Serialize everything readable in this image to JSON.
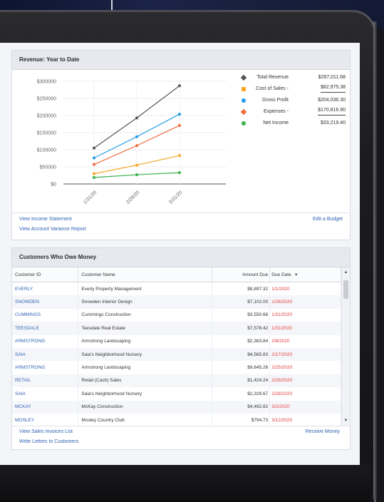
{
  "revenue": {
    "title": "Revenue: Year to Date",
    "links": {
      "income_statement": "View Income Statement",
      "variance_report": "View Account Variance Report",
      "edit_budget": "Edit a Budget"
    },
    "legend": [
      {
        "label": "Total Revenue",
        "value": "$287,011.68",
        "color": "#555555",
        "marker": "diamond",
        "underline": false
      },
      {
        "label": "Cost of Sales -",
        "value": "$82,975.38",
        "color": "#f5a623",
        "marker": "square",
        "underline": true
      },
      {
        "label": "Gross Profit",
        "value": "$204,036.30",
        "color": "#1e9be9",
        "marker": "circle",
        "underline": false
      },
      {
        "label": "Expenses -",
        "value": "$170,816.90",
        "color": "#f26b3a",
        "marker": "diamond",
        "underline": true
      },
      {
        "label": "Net Income",
        "value": "$33,219.40",
        "color": "#35b34a",
        "marker": "circle",
        "underline": false
      }
    ]
  },
  "chart_data": {
    "type": "line",
    "title": "Revenue: Year to Date",
    "categories": [
      "1/31/20",
      "2/28/20",
      "3/31/20"
    ],
    "y_ticks": [
      "$300000",
      "$250000",
      "$200000",
      "$150000",
      "$100000",
      "$50000",
      "$0"
    ],
    "ylim": [
      0,
      300000
    ],
    "grid": true,
    "legend_position": "right",
    "series": [
      {
        "name": "Total Revenue",
        "color": "#555555",
        "values": [
          105000,
          193000,
          287000
        ]
      },
      {
        "name": "Cost of Sales -",
        "color": "#f5a623",
        "values": [
          30000,
          55000,
          83000
        ]
      },
      {
        "name": "Gross Profit",
        "color": "#1e9be9",
        "values": [
          76000,
          138000,
          204000
        ]
      },
      {
        "name": "Expenses -",
        "color": "#f26b3a",
        "values": [
          57000,
          112000,
          171000
        ]
      },
      {
        "name": "Net Income",
        "color": "#35b34a",
        "values": [
          19000,
          27000,
          33000
        ]
      }
    ]
  },
  "customers": {
    "title": "Customers Who Owe Money",
    "columns": {
      "id": "Customer ID",
      "name": "Customer Name",
      "amount": "Amount Due",
      "due": "Due Date"
    },
    "sort_icon": "sort-down-icon",
    "rows": [
      {
        "id": "EVERLY",
        "name": "Everly Property Management",
        "amount": "$8,897.32",
        "due": "1/1/2020"
      },
      {
        "id": "SNOWDEN",
        "name": "Snowden Interior Design",
        "amount": "$7,102.00",
        "due": "1/26/2020"
      },
      {
        "id": "CUMMINGS",
        "name": "Cummings Construction",
        "amount": "$3,550.68",
        "due": "1/31/2020"
      },
      {
        "id": "TEESDALE",
        "name": "Teesdale Real Estate",
        "amount": "$7,578.42",
        "due": "1/31/2020"
      },
      {
        "id": "ARMSTRONG",
        "name": "Armstrong Landscaping",
        "amount": "$2,383.84",
        "due": "2/8/2020"
      },
      {
        "id": "SAIA",
        "name": "Saia's Neighborhood Nursery",
        "amount": "$4,565.83",
        "due": "2/17/2020"
      },
      {
        "id": "ARMSTRONG",
        "name": "Armstrong Landscaping",
        "amount": "$9,645.26",
        "due": "2/25/2020"
      },
      {
        "id": "RETAIL",
        "name": "Retail (Cash) Sales",
        "amount": "$1,424.24",
        "due": "2/28/2020"
      },
      {
        "id": "SAIA",
        "name": "Saia's Neighborhood Nursery",
        "amount": "$2,329.67",
        "due": "2/28/2020"
      },
      {
        "id": "MCKAY",
        "name": "McKay Construction",
        "amount": "$4,492.82",
        "due": "3/2/2020"
      },
      {
        "id": "MOSLEY",
        "name": "Mosley Country Club",
        "amount": "$794.73",
        "due": "3/12/2020"
      }
    ],
    "links": {
      "sales_invoices": "View Sales Invoices List",
      "write_letters": "Write Letters to Customers",
      "receive_money": "Receive Money"
    }
  }
}
